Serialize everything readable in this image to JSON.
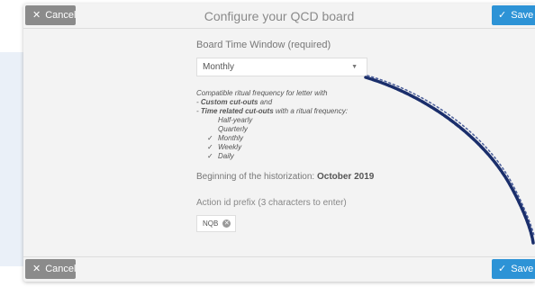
{
  "header": {
    "title": "Configure your QCD board",
    "cancel_label": "Cancel",
    "save_label": "Save"
  },
  "footer": {
    "cancel_label": "Cancel",
    "save_label": "Save"
  },
  "board_time_window": {
    "label": "Board Time Window (required)",
    "selected": "Monthly"
  },
  "help": {
    "line1": "Compatible ritual frequency for letter with",
    "line2_bold": "Custom cut-outs",
    "line2_rest": " and",
    "line3_bold": "Time related cut-outs",
    "line3_rest": " with a ritual frequency:",
    "frequencies": [
      {
        "label": "Half-yearly",
        "checked": false
      },
      {
        "label": "Quarterly",
        "checked": false
      },
      {
        "label": "Monthly",
        "checked": true
      },
      {
        "label": "Weekly",
        "checked": true
      },
      {
        "label": "Daily",
        "checked": true
      }
    ]
  },
  "historization": {
    "label": "Beginning of the historization:",
    "value": "October 2019"
  },
  "action_prefix": {
    "label": "Action id prefix (3 characters to enter)",
    "value": "NQB"
  },
  "colors": {
    "cancel": "#8b8b8b",
    "save": "#2d93d6",
    "scribble": "#1a2e6b"
  },
  "icons": {
    "cancel": "close-icon",
    "save": "check-icon",
    "select": "caret-down-icon",
    "tag_remove": "remove-circle-icon"
  }
}
